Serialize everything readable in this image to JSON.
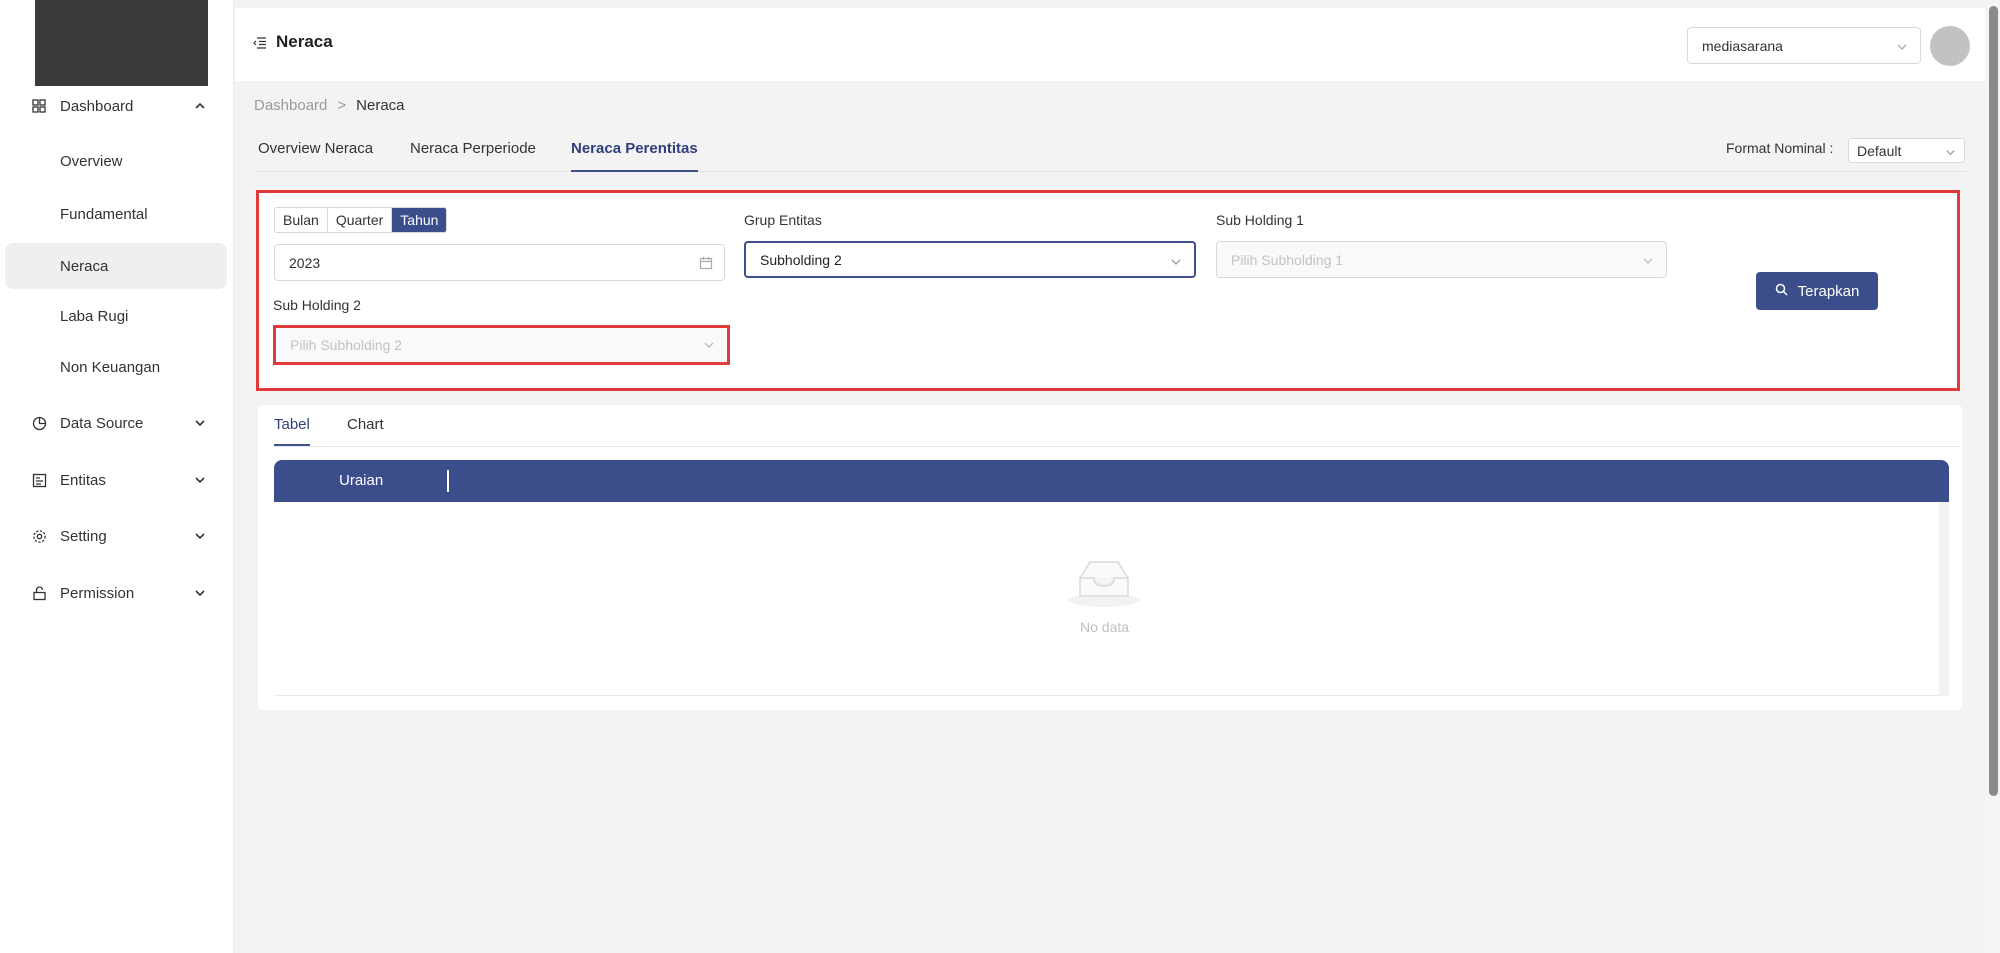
{
  "header": {
    "title": "Neraca",
    "company": "mediasarana"
  },
  "sidebar": {
    "items": [
      {
        "label": "Dashboard",
        "icon": "grid-icon"
      },
      {
        "label": "Data Source",
        "icon": "pie-chart-icon"
      },
      {
        "label": "Entitas",
        "icon": "entity-icon"
      },
      {
        "label": "Setting",
        "icon": "gear-icon"
      },
      {
        "label": "Permission",
        "icon": "unlock-icon"
      }
    ],
    "dashboard_children": [
      "Overview",
      "Fundamental",
      "Neraca",
      "Laba Rugi",
      "Non Keuangan"
    ],
    "active_child": "Neraca"
  },
  "breadcrumb": {
    "root": "Dashboard",
    "separator": ">",
    "current": "Neraca"
  },
  "tabs": [
    "Overview Neraca",
    "Neraca Perperiode",
    "Neraca Perentitas"
  ],
  "active_tab": "Neraca Perentitas",
  "format": {
    "label": "Format Nominal :",
    "value": "Default"
  },
  "filter": {
    "period_options": [
      "Bulan",
      "Quarter",
      "Tahun"
    ],
    "active_period": "Tahun",
    "year": "2023",
    "grup_entitas_label": "Grup Entitas",
    "grup_entitas_value": "Subholding 2",
    "sub_holding_1_label": "Sub Holding 1",
    "sub_holding_1_placeholder": "Pilih Subholding 1",
    "sub_holding_2_label": "Sub Holding 2",
    "sub_holding_2_placeholder": "Pilih Subholding 2",
    "apply_label": "Terapkan"
  },
  "result_tabs": [
    "Tabel",
    "Chart"
  ],
  "active_result_tab": "Tabel",
  "table": {
    "columns": [
      "Uraian"
    ],
    "empty_text": "No data"
  },
  "colors": {
    "primary": "#3b4d8a",
    "highlight": "#e03a3a"
  }
}
